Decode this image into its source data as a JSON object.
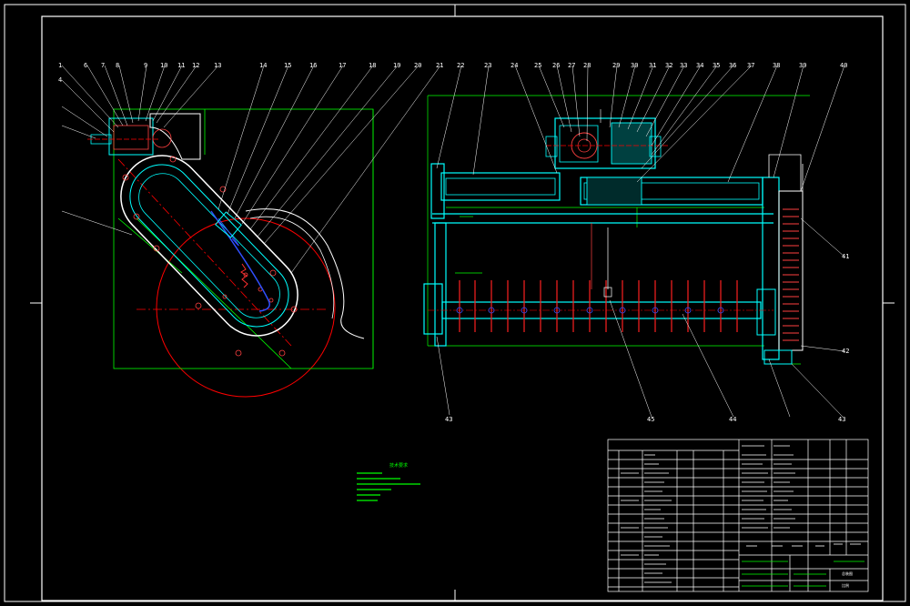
{
  "drawing": {
    "background": "#000000",
    "colors": {
      "frame": "#ffffff",
      "outline": "#00ffff",
      "dimension": "#00ff00",
      "circle": "#ff0000",
      "center_line": "#ff0000",
      "cutter": "#ff0000",
      "blue": "#3050ff",
      "leader": "#ffffff",
      "title_block": "#ffffff",
      "title_accent": "#00ff00"
    },
    "left_view": {
      "labels": [
        "1",
        "4",
        "6",
        "7",
        "8",
        "9",
        "10",
        "11",
        "12",
        "13",
        "14",
        "15",
        "16",
        "17",
        "18",
        "19",
        "20",
        "21"
      ]
    },
    "right_view": {
      "top_labels": [
        "22",
        "23",
        "24",
        "25",
        "26",
        "27",
        "28",
        "29",
        "30",
        "31",
        "32",
        "33",
        "34",
        "35",
        "36",
        "37",
        "38",
        "39",
        "40"
      ],
      "side_labels": [
        "41",
        "42"
      ],
      "bottom_labels": [
        "43",
        "45",
        "44",
        "43"
      ]
    },
    "tech_notes": {
      "title": "技术要求"
    },
    "title_block": {
      "label_a": "总装图",
      "label_b": "比例"
    }
  }
}
